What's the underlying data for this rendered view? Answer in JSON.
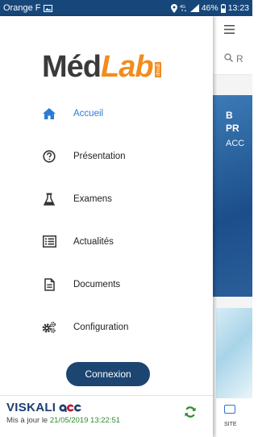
{
  "status_bar": {
    "carrier": "Orange F",
    "battery": "46%",
    "time": "13:23",
    "icons": [
      "gallery-icon",
      "location-icon",
      "data-icon",
      "signal-icon",
      "battery-icon"
    ]
  },
  "drawer": {
    "logo": {
      "text_med": "Méd",
      "text_lab": "Lab",
      "group": "group"
    },
    "menu": [
      {
        "label": "Accueil",
        "icon": "home-icon",
        "active": true
      },
      {
        "label": "Présentation",
        "icon": "question-circle-icon",
        "active": false
      },
      {
        "label": "Examens",
        "icon": "flask-icon",
        "active": false
      },
      {
        "label": "Actualités",
        "icon": "newspaper-icon",
        "active": false
      },
      {
        "label": "Documents",
        "icon": "document-icon",
        "active": false
      },
      {
        "label": "Configuration",
        "icon": "gears-icon",
        "active": false
      }
    ],
    "connect_button": "Connexion",
    "footer": {
      "brand_name": "VISKALI",
      "brand_suffix": "acc",
      "update_prefix": "Mis à jour le ",
      "update_date": "21/05/2019 13:22:51"
    }
  },
  "background_app": {
    "search_placeholder": "R",
    "banner_line1": "B",
    "banner_line2": "PR",
    "banner_sub": "ACC",
    "card_text": "SITE"
  },
  "colors": {
    "status_bar": "#17477a",
    "active": "#2d7bd6",
    "button": "#1c4572",
    "logo_orange": "#f28c1e",
    "update_date": "#2e8b2e"
  }
}
